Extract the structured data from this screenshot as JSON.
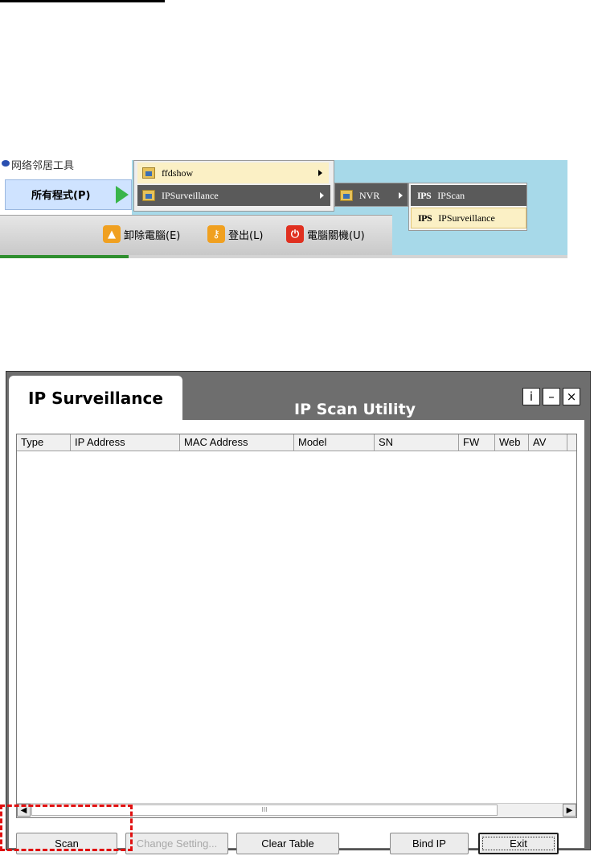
{
  "start_menu": {
    "recent_item_partial": "网络邻居工具",
    "all_programs_label": "所有程式(P)",
    "programs": [
      {
        "label": "ffdshow"
      },
      {
        "label": "IPSurveillance"
      }
    ],
    "nvr_label": "NVR",
    "ips_items": [
      {
        "logo": "IPS",
        "label": "IPScan"
      },
      {
        "logo": "IPS",
        "label": "IPSurveillance"
      }
    ],
    "system_buttons": [
      {
        "label": "卸除電腦(E)",
        "icon": "eject-icon",
        "color": "#f0a020"
      },
      {
        "label": "登出(L)",
        "icon": "key-icon",
        "color": "#f0a020"
      },
      {
        "label": "電腦關機(U)",
        "icon": "power-icon",
        "color": "#e03020"
      }
    ]
  },
  "app": {
    "tab_title": "IP Surveillance",
    "utility_title": "IP Scan Utility",
    "window_controls": [
      {
        "name": "info-button",
        "glyph": "i"
      },
      {
        "name": "minimize-button",
        "glyph": "–"
      },
      {
        "name": "close-button",
        "glyph": "×"
      }
    ],
    "table": {
      "columns": [
        "Type",
        "IP Address",
        "MAC Address",
        "Model",
        "SN",
        "FW",
        "Web",
        "AV"
      ],
      "rows": []
    },
    "scrollbar_thumb_marker": "III",
    "buttons": {
      "scan": "Scan",
      "change_setting": "Change Setting...",
      "clear_table": "Clear Table",
      "bind_ip": "Bind IP",
      "exit": "Exit"
    },
    "highlight_color": "#e01010"
  }
}
